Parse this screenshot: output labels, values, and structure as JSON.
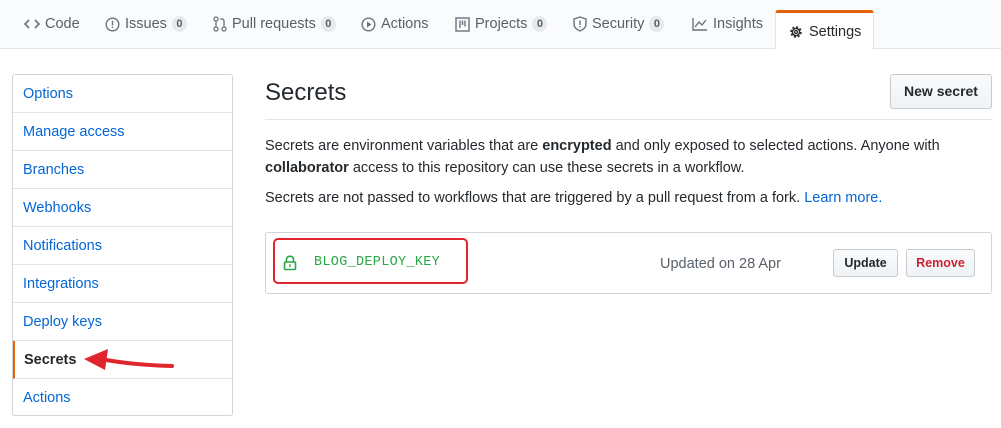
{
  "tabs": [
    {
      "label": "Code",
      "icon": "code-icon"
    },
    {
      "label": "Issues",
      "icon": "issue-icon",
      "count": "0"
    },
    {
      "label": "Pull requests",
      "icon": "pull-request-icon",
      "count": "0"
    },
    {
      "label": "Actions",
      "icon": "play-icon"
    },
    {
      "label": "Projects",
      "icon": "project-icon",
      "count": "0"
    },
    {
      "label": "Security",
      "icon": "shield-icon",
      "count": "0"
    },
    {
      "label": "Insights",
      "icon": "graph-icon"
    },
    {
      "label": "Settings",
      "icon": "gear-icon",
      "selected": true
    }
  ],
  "sidebar": {
    "items": [
      {
        "label": "Options"
      },
      {
        "label": "Manage access"
      },
      {
        "label": "Branches"
      },
      {
        "label": "Webhooks"
      },
      {
        "label": "Notifications"
      },
      {
        "label": "Integrations"
      },
      {
        "label": "Deploy keys"
      },
      {
        "label": "Secrets",
        "selected": true
      },
      {
        "label": "Actions"
      }
    ]
  },
  "main": {
    "title": "Secrets",
    "new_button": "New secret",
    "description": {
      "part1": "Secrets are environment variables that are ",
      "bold1": "encrypted",
      "part2": " and only exposed to selected actions. Anyone with",
      "bold2": "collaborator",
      "part3": " access to this repository can use these secrets in a workflow."
    },
    "fork_note": {
      "text": "Secrets are not passed to workflows that are triggered by a pull request from a fork. ",
      "link": "Learn more."
    },
    "secrets": [
      {
        "name": "BLOG_DEPLOY_KEY",
        "updated": "Updated on 28 Apr",
        "update_label": "Update",
        "remove_label": "Remove"
      }
    ]
  },
  "colors": {
    "accent": "#e36209",
    "link": "#0366d6",
    "secret_green": "#28a745",
    "danger": "#cb2431",
    "annotation_red": "#e0252d"
  }
}
